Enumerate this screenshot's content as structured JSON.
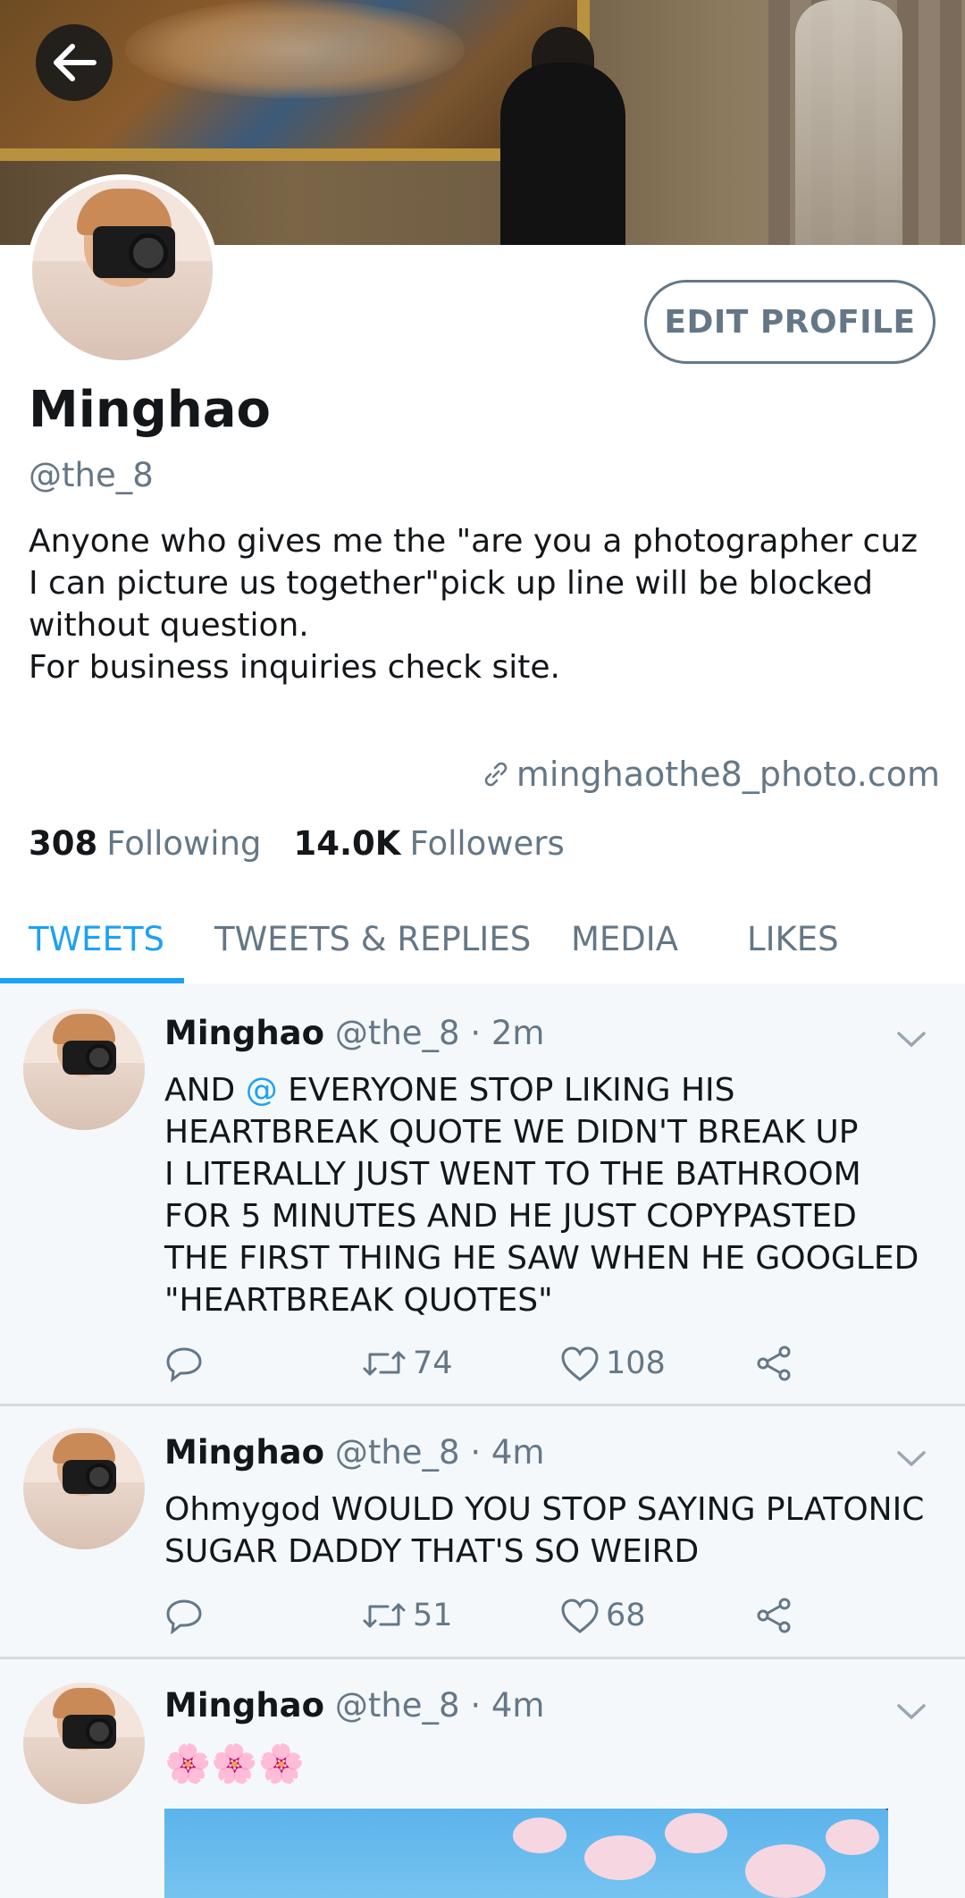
{
  "profile": {
    "name": "Minghao",
    "handle": "@the_8",
    "bio": "Anyone who gives me the \"are you a photographer cuz\nI can picture us together\"pick up line will be blocked\nwithout question.\nFor business inquiries check site.",
    "website": "minghaothe8_photo.com",
    "following_count": "308",
    "following_label": "Following",
    "followers_count": "14.0K",
    "followers_label": "Followers",
    "edit_button": "EDIT PROFILE"
  },
  "tabs": [
    {
      "label": "TWEETS",
      "active": true
    },
    {
      "label": "TWEETS & REPLIES",
      "active": false
    },
    {
      "label": "MEDIA",
      "active": false
    },
    {
      "label": "LIKES",
      "active": false
    }
  ],
  "tweets": [
    {
      "name": "Minghao",
      "meta": "@the_8 · 2m",
      "text_before_mention": "AND ",
      "mention": "@",
      "text_after_mention": " EVERYONE STOP LIKING HIS\nHEARTBREAK QUOTE WE DIDN'T BREAK UP\nI LITERALLY JUST WENT TO THE BATHROOM\nFOR 5 MINUTES AND HE JUST COPYPASTED\nTHE FIRST THING HE SAW WHEN HE GOOGLED\n\"HEARTBREAK QUOTES\"",
      "retweets": "74",
      "likes": "108"
    },
    {
      "name": "Minghao",
      "meta": "@the_8 · 4m",
      "text": "Ohmygod WOULD YOU STOP SAYING PLATONIC\nSUGAR DADDY THAT'S SO WEIRD",
      "retweets": "51",
      "likes": "68"
    },
    {
      "name": "Minghao",
      "meta": "@the_8 · 4m",
      "emoji": "🌸🌸🌸"
    }
  ],
  "colors": {
    "accent": "#1da1f2",
    "muted": "#657786",
    "text": "#14171a"
  },
  "icons": [
    "back-arrow-icon",
    "link-icon",
    "chevron-down-icon",
    "reply-icon",
    "retweet-icon",
    "like-icon",
    "share-icon"
  ]
}
